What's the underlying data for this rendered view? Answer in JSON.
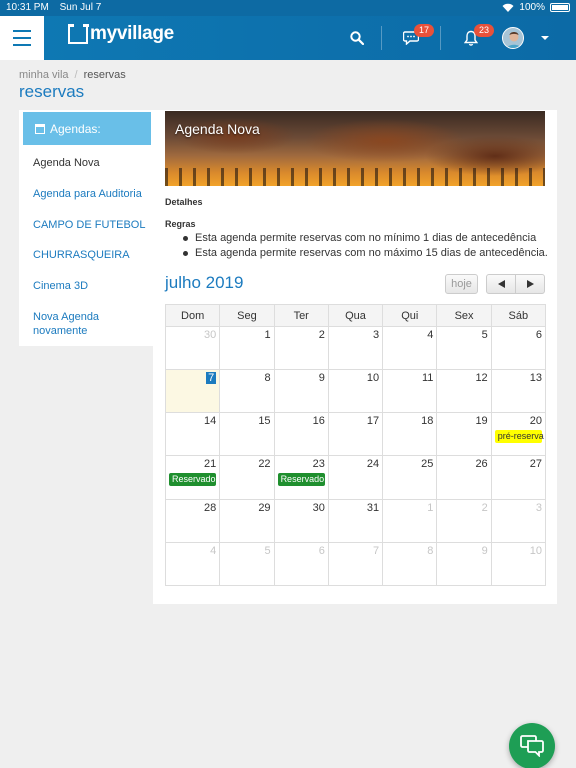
{
  "status_bar": {
    "time": "10:31 PM",
    "date": "Sun Jul 7",
    "battery": "100%"
  },
  "header": {
    "logo_text": "myvillage",
    "messages_badge": "17",
    "notifications_badge": "23",
    "icons": [
      "menu-icon",
      "search-icon",
      "chat-icon",
      "bell-icon",
      "user-avatar",
      "chevron-down-icon"
    ]
  },
  "breadcrumb": {
    "items": [
      "minha vila",
      "reservas"
    ],
    "separator": "/"
  },
  "page_title": "reservas",
  "sidebar": {
    "heading": "Agendas:",
    "items": [
      {
        "label": "Agenda Nova",
        "active": true
      },
      {
        "label": "Agenda para Auditoria",
        "active": false
      },
      {
        "label": "CAMPO DE FUTEBOL",
        "active": false
      },
      {
        "label": "CHURRASQUEIRA",
        "active": false
      },
      {
        "label": "Cinema 3D",
        "active": false
      },
      {
        "label": "Nova Agenda novamente",
        "active": false
      }
    ]
  },
  "agenda": {
    "title": "Agenda Nova",
    "details_label": "Detalhes",
    "rules_label": "Regras",
    "rules": [
      "Esta agenda permite reservas com no mínimo 1 dias de antecedência",
      "Esta agenda permite reservas com no máximo 15 dias de antecedência."
    ]
  },
  "calendar": {
    "month_title": "julho 2019",
    "today_button": "hoje",
    "weekdays": [
      "Dom",
      "Seg",
      "Ter",
      "Qua",
      "Qui",
      "Sex",
      "Sáb"
    ],
    "weeks": [
      [
        {
          "d": "30",
          "other": true
        },
        {
          "d": "1"
        },
        {
          "d": "2"
        },
        {
          "d": "3"
        },
        {
          "d": "4"
        },
        {
          "d": "5"
        },
        {
          "d": "6"
        }
      ],
      [
        {
          "d": "7",
          "today": true
        },
        {
          "d": "8"
        },
        {
          "d": "9"
        },
        {
          "d": "10"
        },
        {
          "d": "11"
        },
        {
          "d": "12"
        },
        {
          "d": "13"
        }
      ],
      [
        {
          "d": "14"
        },
        {
          "d": "15"
        },
        {
          "d": "16"
        },
        {
          "d": "17"
        },
        {
          "d": "18"
        },
        {
          "d": "19"
        },
        {
          "d": "20",
          "event": "pré-reserva",
          "event_type": "pre"
        }
      ],
      [
        {
          "d": "21",
          "event": "Reservado",
          "event_type": "reservado"
        },
        {
          "d": "22"
        },
        {
          "d": "23",
          "event": "Reservado",
          "event_type": "reservado"
        },
        {
          "d": "24"
        },
        {
          "d": "25"
        },
        {
          "d": "26"
        },
        {
          "d": "27"
        }
      ],
      [
        {
          "d": "28"
        },
        {
          "d": "29"
        },
        {
          "d": "30"
        },
        {
          "d": "31"
        },
        {
          "d": "1",
          "other": true
        },
        {
          "d": "2",
          "other": true
        },
        {
          "d": "3",
          "other": true
        }
      ],
      [
        {
          "d": "4",
          "other": true
        },
        {
          "d": "5",
          "other": true
        },
        {
          "d": "6",
          "other": true
        },
        {
          "d": "7",
          "other": true
        },
        {
          "d": "8",
          "other": true
        },
        {
          "d": "9",
          "other": true
        },
        {
          "d": "10",
          "other": true
        }
      ]
    ]
  },
  "colors": {
    "brand_blue": "#0e79b4",
    "link_blue": "#1c7bbf",
    "reserved_green": "#1f8f2e",
    "pre_reserve_yellow": "#ffff00",
    "badge_red": "#e8513a",
    "fab_green": "#1e9e55"
  }
}
